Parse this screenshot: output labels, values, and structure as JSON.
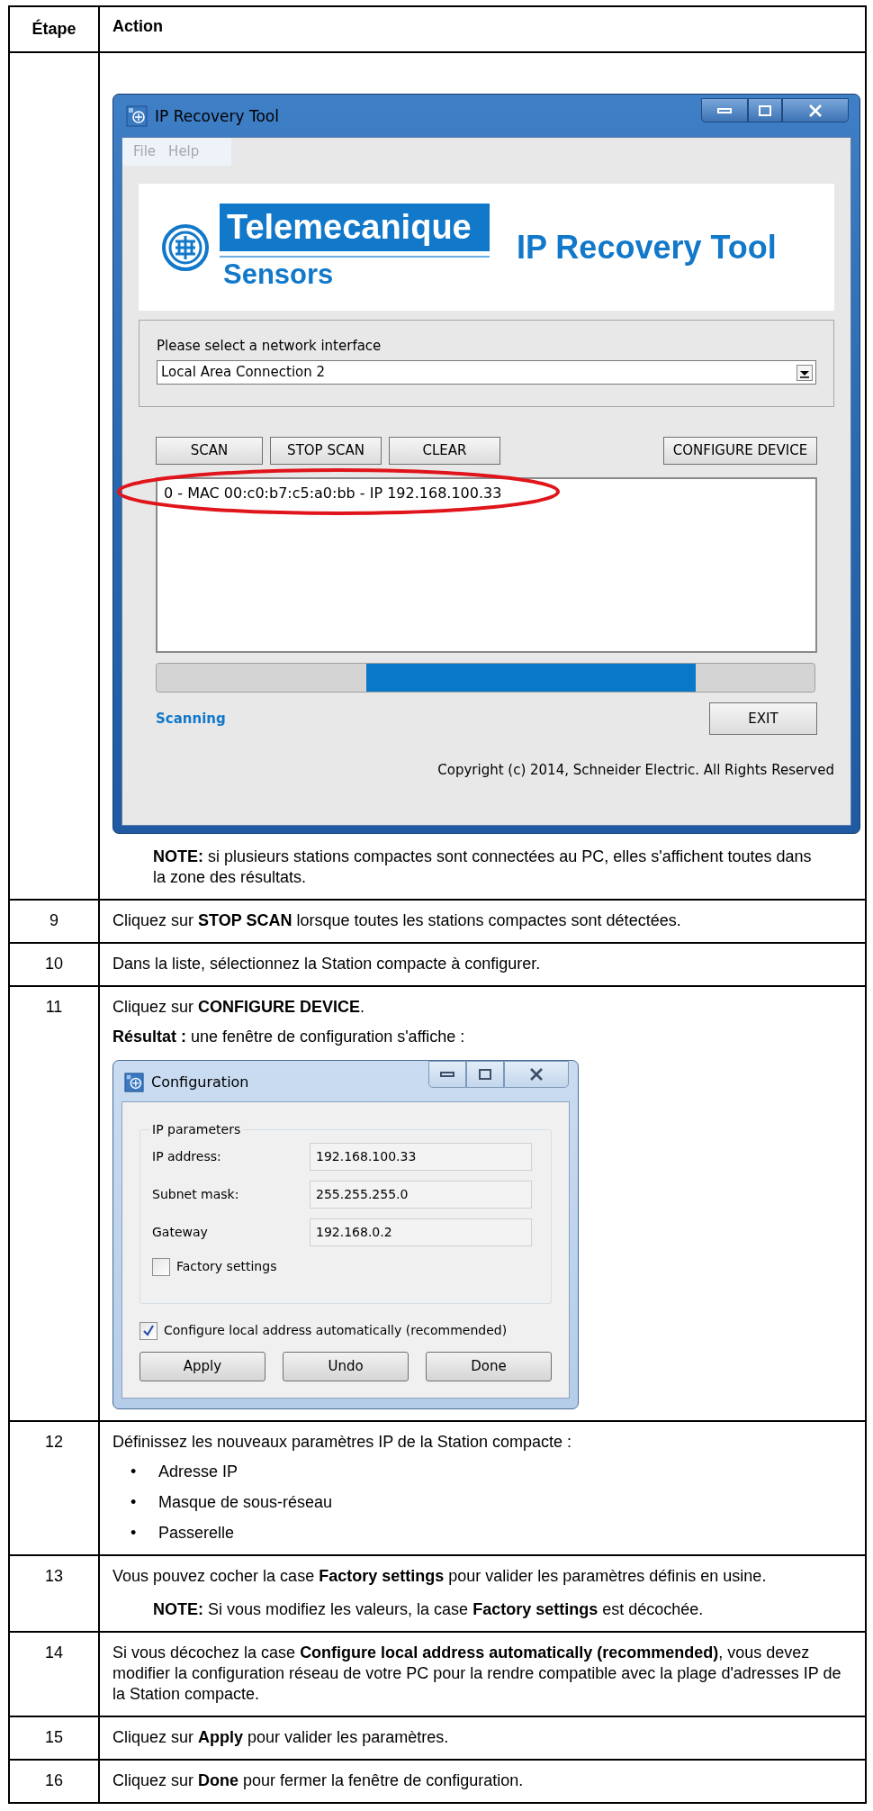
{
  "table": {
    "columns": [
      {
        "label": "Étape"
      },
      {
        "label": "Action"
      }
    ],
    "rows": [
      {
        "blocks": [
          {
            "kind": "ip_recovery_window",
            "window": {
              "title": "IP Recovery Tool",
              "menu": [
                "File",
                "Help"
              ],
              "logo": {
                "brand": "Telemecanique",
                "sub": "Sensors",
                "product": "IP Recovery Tool"
              },
              "interface_label": "Please select a network interface",
              "interface_value": "Local Area Connection 2",
              "buttons": [
                "SCAN",
                "STOP SCAN",
                "CLEAR"
              ],
              "configure_button": "CONFIGURE DEVICE",
              "results": [
                {
                  "text": "0 - MAC 00:c0:b7:c5:a0:bb - IP 192.168.100.33",
                  "circled": true
                }
              ],
              "status": "Scanning",
              "exit_button": "EXIT",
              "copyright": "Copyright (c) 2014, Schneider Electric. All Rights Reserved"
            }
          },
          {
            "kind": "note",
            "text": "**NOTE:** si plusieurs stations compactes sont connectées au PC, elles s'affichent toutes dans la zone des résultats."
          }
        ]
      },
      {
        "step": "9",
        "blocks": [
          {
            "kind": "paragraph",
            "text": "Cliquez sur **STOP SCAN** lorsque toutes les stations compactes sont détectées."
          }
        ]
      },
      {
        "step": "10",
        "blocks": [
          {
            "kind": "paragraph",
            "text": "Dans la liste, sélectionnez la Station compacte à configurer."
          }
        ]
      },
      {
        "step": "11",
        "blocks": [
          {
            "kind": "paragraph",
            "text": "Cliquez sur **CONFIGURE DEVICE**."
          },
          {
            "kind": "paragraph",
            "text": "**Résultat :** une fenêtre de configuration s'affiche :"
          },
          {
            "kind": "configuration_window",
            "window": {
              "title": "Configuration",
              "group_label": "IP parameters",
              "fields": [
                {
                  "label": "IP address:",
                  "value": "192.168.100.33"
                },
                {
                  "label": "Subnet mask:",
                  "value": "255.255.255.0"
                },
                {
                  "label": "Gateway",
                  "value": "192.168.0.2"
                }
              ],
              "factory": {
                "label": "Factory settings",
                "checked": false
              },
              "auto": {
                "label": "Configure local address automatically (recommended)",
                "checked": true
              },
              "buttons": [
                "Apply",
                "Undo",
                "Done"
              ]
            }
          }
        ]
      },
      {
        "step": "12",
        "blocks": [
          {
            "kind": "paragraph",
            "text": "Définissez les nouveaux paramètres IP de la Station compacte :"
          },
          {
            "kind": "bullets",
            "items": [
              {
                "bullet": "•",
                "text": "Adresse IP"
              },
              {
                "bullet": "•",
                "text": "Masque de sous-réseau"
              },
              {
                "bullet": "•",
                "text": "Passerelle"
              }
            ]
          }
        ]
      },
      {
        "step": "13",
        "blocks": [
          {
            "kind": "paragraph",
            "text": "Vous pouvez cocher la case **Factory settings** pour valider les paramètres définis en usine."
          },
          {
            "kind": "note",
            "text": "**NOTE:** Si vous modifiez les valeurs, la case **Factory settings** est décochée."
          }
        ]
      },
      {
        "step": "14",
        "blocks": [
          {
            "kind": "paragraph",
            "text": "Si vous décochez la case **Configure local address automatically (recommended)**, vous devez modifier la configuration réseau de votre PC pour la rendre compatible avec la plage d'adresses IP de la Station compacte."
          }
        ]
      },
      {
        "step": "15",
        "blocks": [
          {
            "kind": "paragraph",
            "text": "Cliquez sur **Apply** pour valider les paramètres."
          }
        ]
      },
      {
        "step": "16",
        "blocks": [
          {
            "kind": "paragraph",
            "text": "Cliquez sur **Done** pour fermer la fenêtre de configuration."
          }
        ]
      }
    ]
  }
}
